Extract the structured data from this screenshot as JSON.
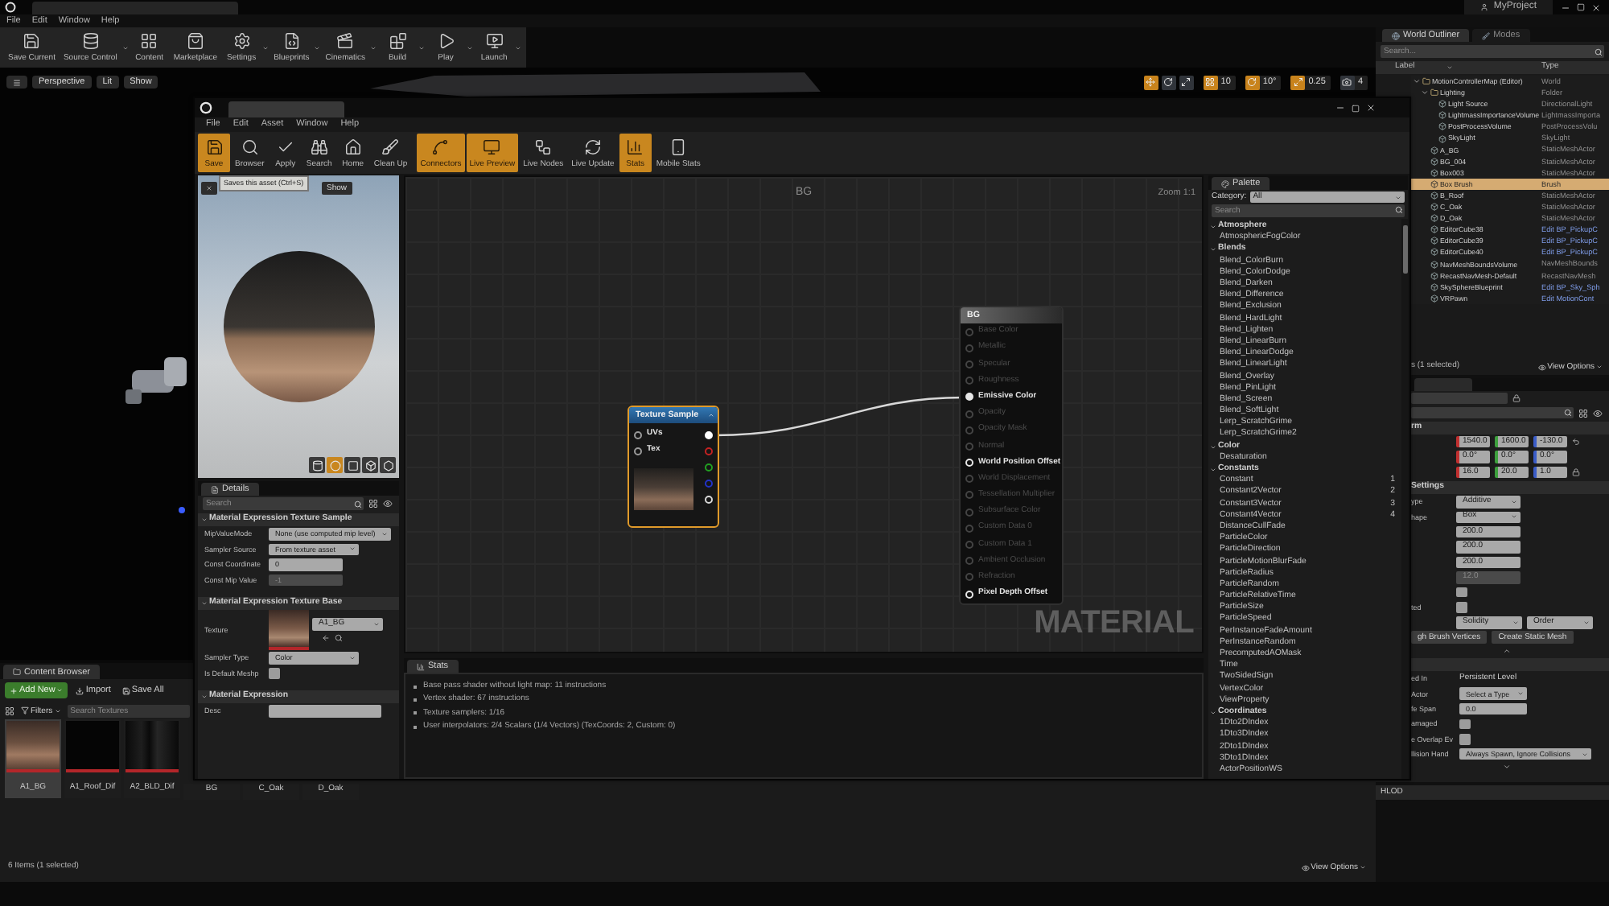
{
  "editor": {
    "project_name": "MyProject",
    "menu": [
      "File",
      "Edit",
      "Window",
      "Help"
    ],
    "toolbar": [
      {
        "label": "Save Current",
        "menu": false
      },
      {
        "label": "Source Control",
        "menu": true
      },
      {
        "label": "Content",
        "menu": false
      },
      {
        "label": "Marketplace",
        "menu": false
      },
      {
        "label": "Settings",
        "menu": true
      },
      {
        "label": "Blueprints",
        "menu": true
      },
      {
        "label": "Cinematics",
        "menu": true
      },
      {
        "label": "Build",
        "menu": true
      },
      {
        "label": "Play",
        "menu": true
      },
      {
        "label": "Launch",
        "menu": true
      }
    ]
  },
  "viewport": {
    "buttons": [
      "Perspective",
      "Lit",
      "Show"
    ],
    "transform_tools": [
      {
        "selected": true
      },
      {
        "selected": false
      },
      {
        "selected": false
      }
    ],
    "snap_settings": [
      {
        "reading": "10",
        "on": true
      },
      {
        "reading": "10°",
        "on": true
      },
      {
        "reading": "0.25",
        "on": true
      },
      {
        "reading": "4",
        "on": false
      }
    ]
  },
  "content_browser": {
    "tab": "Content Browser",
    "add_new": "Add New",
    "import": "Import",
    "save_all": "Save All",
    "filters": "Filters",
    "search": {
      "placeholder": "Search Textures"
    },
    "assets": [
      {
        "name": "A1_BG",
        "kind": "texture",
        "selected": true
      },
      {
        "name": "A1_Roof_Dif",
        "kind": "texture",
        "selected": false
      },
      {
        "name": "A2_BLD_Dif",
        "kind": "texture",
        "selected": false
      },
      {
        "name": "BG",
        "kind": "material",
        "selected": false
      },
      {
        "name": "C_Oak",
        "kind": "material",
        "selected": false
      },
      {
        "name": "D_Oak",
        "kind": "material",
        "selected": false
      }
    ],
    "status": "6 Items (1 selected)",
    "view_options": "View Options"
  },
  "outliner": {
    "tabs": [
      {
        "label": "World Outliner",
        "selected": true
      },
      {
        "label": "Modes",
        "selected": false
      }
    ],
    "search": {
      "placeholder": "Search..."
    },
    "columns": [
      "Label",
      "Type"
    ],
    "rows": [
      {
        "label": "MotionControllerMap (Editor)",
        "type": "World",
        "selected": false,
        "blueprint": false,
        "expanded": true,
        "children": [
          {
            "label": "Lighting",
            "type": "Folder",
            "selected": false,
            "blueprint": false,
            "expanded": true,
            "children": [
              {
                "label": "Light Source",
                "type": "DirectionalLight",
                "selected": false,
                "blueprint": false
              },
              {
                "label": "LightmassImportanceVolume",
                "type": "LightmassImporta",
                "selected": false,
                "blueprint": false
              },
              {
                "label": "PostProcessVolume",
                "type": "PostProcessVolu",
                "selected": false,
                "blueprint": false
              },
              {
                "label": "SkyLight",
                "type": "SkyLight",
                "selected": false,
                "blueprint": false
              }
            ]
          },
          {
            "label": "A_BG",
            "type": "StaticMeshActor",
            "selected": false,
            "blueprint": false
          },
          {
            "label": "BG_004",
            "type": "StaticMeshActor",
            "selected": false,
            "blueprint": false
          },
          {
            "label": "Box003",
            "type": "StaticMeshActor",
            "selected": false,
            "blueprint": false
          },
          {
            "label": "Box Brush",
            "type": "Brush",
            "selected": true,
            "blueprint": false
          },
          {
            "label": "B_Roof",
            "type": "StaticMeshActor",
            "selected": false,
            "blueprint": false
          },
          {
            "label": "C_Oak",
            "type": "StaticMeshActor",
            "selected": false,
            "blueprint": false
          },
          {
            "label": "D_Oak",
            "type": "StaticMeshActor",
            "selected": false,
            "blueprint": false
          },
          {
            "label": "EditorCube38",
            "type": "Edit BP_PickupC",
            "selected": false,
            "blueprint": true
          },
          {
            "label": "EditorCube39",
            "type": "Edit BP_PickupC",
            "selected": false,
            "blueprint": true
          },
          {
            "label": "EditorCube40",
            "type": "Edit BP_PickupC",
            "selected": false,
            "blueprint": true
          },
          {
            "label": "NavMeshBoundsVolume",
            "type": "NavMeshBounds",
            "selected": false,
            "blueprint": false
          },
          {
            "label": "RecastNavMesh-Default",
            "type": "RecastNavMesh",
            "selected": false,
            "blueprint": false
          },
          {
            "label": "SkySphereBlueprint",
            "type": "Edit BP_Sky_Sph",
            "selected": false,
            "blueprint": true
          },
          {
            "label": "VRPawn",
            "type": "Edit MotionCont",
            "selected": false,
            "blueprint": true
          }
        ]
      }
    ],
    "footer": "s (1 selected)",
    "view_options": "View Options"
  },
  "details": {
    "transform": {
      "title": "rm",
      "rows": [
        [
          "1540.0",
          "1600.0",
          "-130.0"
        ],
        [
          "0.0°",
          "0.0°",
          "0.0°"
        ],
        [
          "16.0",
          "20.0",
          "1.0"
        ]
      ]
    },
    "brush_settings": {
      "title": "Settings",
      "rows": [
        {
          "label": "ype",
          "kind": "dropdown",
          "value": "Additive",
          "disabled": false
        },
        {
          "label": "hape",
          "kind": "dropdown",
          "value": "Box",
          "disabled": false
        },
        {
          "kind": "number",
          "value": "200.0",
          "disabled": false
        },
        {
          "kind": "number",
          "value": "200.0",
          "disabled": false
        },
        {
          "kind": "number",
          "value": "200.0",
          "disabled": false
        },
        {
          "kind": "number",
          "value": "12.0",
          "disabled": true
        },
        {
          "kind": "checkbox",
          "checked": false,
          "disabled": false
        },
        {
          "label": "ted",
          "kind": "checkbox",
          "checked": false,
          "disabled": false
        }
      ]
    },
    "brush_options": [
      "Solidity",
      "Order"
    ],
    "brush_actions": [
      "gh Brush Vertices",
      "Create Static Mesh"
    ],
    "brush_advanced": {
      "expanded": true
    },
    "actor_rows": [
      {
        "label": "ed In",
        "kind": "text",
        "value": "Persistent Level",
        "disabled": false
      },
      {
        "label": "Actor",
        "kind": "dropdown",
        "value": "Select a Type",
        "disabled": false
      },
      {
        "label": "fe Span",
        "kind": "number",
        "value": "0.0",
        "disabled": false
      },
      {
        "label": "amaged",
        "kind": "checkbox",
        "checked": false,
        "disabled": false
      },
      {
        "label": "e Overlap Ev",
        "kind": "checkbox",
        "checked": false,
        "disabled": false
      },
      {
        "label": "llision Hand",
        "kind": "dropdown",
        "value": "Always Spawn, Ignore Collisions",
        "disabled": false
      }
    ],
    "actor_advanced": {
      "expanded": false
    }
  },
  "hlod": "HLOD",
  "material_editor": {
    "menu": [
      "File",
      "Edit",
      "Asset",
      "Window",
      "Help"
    ],
    "toolbar": [
      {
        "label": "Save",
        "active": true
      },
      {
        "label": "Browser",
        "active": false
      },
      {
        "label": "Apply",
        "active": false
      },
      {
        "label": "Search",
        "active": false
      },
      {
        "label": "Home",
        "active": false
      },
      {
        "label": "Clean Up",
        "active": false
      },
      {
        "label": "Connectors",
        "active": true
      },
      {
        "label": "Live Preview",
        "active": true
      },
      {
        "label": "Live Nodes",
        "active": false
      },
      {
        "label": "Live Update",
        "active": false
      },
      {
        "label": "Stats",
        "active": true
      },
      {
        "label": "Mobile Stats",
        "active": false
      }
    ],
    "tooltip": "Saves this asset (Ctrl+S)",
    "preview": {
      "show_button": "Show",
      "view_modes": [
        {
          "selected": false
        },
        {
          "selected": true
        },
        {
          "selected": false
        },
        {
          "selected": false
        },
        {
          "selected": false
        }
      ]
    },
    "details": {
      "tab": "Details",
      "search": {
        "placeholder": "Search"
      },
      "sections": [
        {
          "title": "Material Expression Texture Sample",
          "expanded": true,
          "rows": [
            {
              "label": "MipValueMode",
              "kind": "dropdown",
              "value": "None (use computed mip level)",
              "disabled": false
            },
            {
              "label": "Sampler Source",
              "kind": "dropdown",
              "value": "From texture asset",
              "disabled": false
            },
            {
              "label": "Const Coordinate",
              "kind": "number",
              "value": "0",
              "disabled": false
            },
            {
              "label": "Const Mip Value",
              "kind": "number",
              "value": "-1",
              "disabled": true
            }
          ]
        },
        {
          "title": "Material Expression Texture Base",
          "expanded": true,
          "rows": [
            {
              "label": "Texture",
              "kind": "asset",
              "value": "A1_BG",
              "disabled": false
            },
            {
              "label": "Sampler Type",
              "kind": "dropdown",
              "value": "Color",
              "disabled": false
            },
            {
              "label": "Is Default Meshp",
              "kind": "checkbox",
              "checked": false,
              "disabled": false
            }
          ]
        },
        {
          "title": "Material Expression",
          "expanded": true,
          "rows": [
            {
              "label": "Desc",
              "kind": "input",
              "disabled": false
            }
          ]
        }
      ]
    },
    "graph": {
      "title": "BG",
      "zoom": "Zoom 1:1",
      "label": "MATERIAL",
      "texture_node": {
        "title": "Texture Sample",
        "inputs": [
          "UVs",
          "Tex"
        ],
        "outputs": [
          {
            "color": "#ffffff",
            "connected": true
          },
          {
            "color": "#c42222",
            "connected": false
          },
          {
            "color": "#22a022",
            "connected": false
          },
          {
            "color": "#2233c8",
            "connected": false
          },
          {
            "color": "#d8d8d8",
            "connected": false
          }
        ]
      },
      "result_node": {
        "title": "BG",
        "pins": [
          {
            "label": "Base Color",
            "disabled": true,
            "connected": false
          },
          {
            "label": "Metallic",
            "disabled": true,
            "connected": false
          },
          {
            "label": "Specular",
            "disabled": true,
            "connected": false
          },
          {
            "label": "Roughness",
            "disabled": true,
            "connected": false
          },
          {
            "label": "Emissive Color",
            "disabled": false,
            "connected": true
          },
          {
            "label": "Opacity",
            "disabled": true,
            "connected": false
          },
          {
            "label": "Opacity Mask",
            "disabled": true,
            "connected": false
          },
          {
            "label": "Normal",
            "disabled": true,
            "connected": false
          },
          {
            "label": "World Position Offset",
            "disabled": false,
            "connected": false
          },
          {
            "label": "World Displacement",
            "disabled": true,
            "connected": false
          },
          {
            "label": "Tessellation Multiplier",
            "disabled": true,
            "connected": false
          },
          {
            "label": "Subsurface Color",
            "disabled": true,
            "connected": false
          },
          {
            "label": "Custom Data 0",
            "disabled": true,
            "connected": false
          },
          {
            "label": "Custom Data 1",
            "disabled": true,
            "connected": false
          },
          {
            "label": "Ambient Occlusion",
            "disabled": true,
            "connected": false
          },
          {
            "label": "Refraction",
            "disabled": true,
            "connected": false
          },
          {
            "label": "Pixel Depth Offset",
            "disabled": false,
            "connected": false
          }
        ]
      }
    },
    "stats": {
      "tab": "Stats",
      "lines": [
        "Base pass shader without light map: 11 instructions",
        "Vertex shader: 67 instructions",
        "Texture samplers: 1/16",
        "User interpolators: 2/4 Scalars (1/4 Vectors) (TexCoords: 2, Custom: 0)"
      ]
    },
    "palette": {
      "tab": "Palette",
      "category_label": "Category:",
      "category": "All",
      "search": {
        "placeholder": "Search"
      },
      "groups": [
        {
          "label": "Atmosphere",
          "expanded": true,
          "children": [
            {
              "label": "AtmosphericFogColor"
            }
          ]
        },
        {
          "label": "Blends",
          "expanded": true,
          "children": [
            {
              "label": "Blend_ColorBurn"
            },
            {
              "label": "Blend_ColorDodge"
            },
            {
              "label": "Blend_Darken"
            },
            {
              "label": "Blend_Difference"
            },
            {
              "label": "Blend_Exclusion"
            },
            {
              "label": "Blend_HardLight"
            },
            {
              "label": "Blend_Lighten"
            },
            {
              "label": "Blend_LinearBurn"
            },
            {
              "label": "Blend_LinearDodge"
            },
            {
              "label": "Blend_LinearLight"
            },
            {
              "label": "Blend_Overlay"
            },
            {
              "label": "Blend_PinLight"
            },
            {
              "label": "Blend_Screen"
            },
            {
              "label": "Blend_SoftLight"
            },
            {
              "label": "Lerp_ScratchGrime"
            },
            {
              "label": "Lerp_ScratchGrime2"
            }
          ]
        },
        {
          "label": "Color",
          "expanded": true,
          "children": [
            {
              "label": "Desaturation"
            }
          ]
        },
        {
          "label": "Constants",
          "expanded": true,
          "children": [
            {
              "label": "Constant",
              "shortcut": "1"
            },
            {
              "label": "Constant2Vector",
              "shortcut": "2"
            },
            {
              "label": "Constant3Vector",
              "shortcut": "3"
            },
            {
              "label": "Constant4Vector",
              "shortcut": "4"
            },
            {
              "label": "DistanceCullFade"
            },
            {
              "label": "ParticleColor"
            },
            {
              "label": "ParticleDirection"
            },
            {
              "label": "ParticleMotionBlurFade"
            },
            {
              "label": "ParticleRadius"
            },
            {
              "label": "ParticleRandom"
            },
            {
              "label": "ParticleRelativeTime"
            },
            {
              "label": "ParticleSize"
            },
            {
              "label": "ParticleSpeed"
            },
            {
              "label": "PerInstanceFadeAmount"
            },
            {
              "label": "PerInstanceRandom"
            },
            {
              "label": "PrecomputedAOMask"
            },
            {
              "label": "Time"
            },
            {
              "label": "TwoSidedSign"
            },
            {
              "label": "VertexColor"
            },
            {
              "label": "ViewProperty"
            }
          ]
        },
        {
          "label": "Coordinates",
          "expanded": true,
          "children": [
            {
              "label": "1Dto2DIndex"
            },
            {
              "label": "1Dto3DIndex"
            },
            {
              "label": "2Dto1DIndex"
            },
            {
              "label": "3Dto1DIndex"
            },
            {
              "label": "ActorPositionWS"
            }
          ]
        }
      ]
    }
  }
}
